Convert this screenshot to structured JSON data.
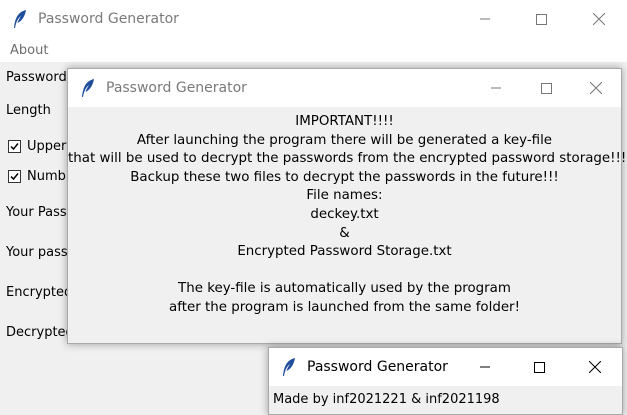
{
  "main_window": {
    "title": "Password Generator",
    "menu": [
      "About"
    ],
    "labels": {
      "password": "Password",
      "length": "Length",
      "upper": "Upper",
      "numbers": "Numb",
      "your_pass": "Your Pass",
      "your_pass2": "Your pass",
      "encrypted": "Encrypted",
      "decrypted": "Decrypted"
    },
    "checkbox_upper_checked": true,
    "checkbox_numbers_checked": true
  },
  "info_dialog": {
    "title": "Password Generator",
    "lines": [
      "IMPORTANT!!!!",
      "After launching the program there will be generated a key-file",
      "that will be used to decrypt the passwords from the encrypted password storage!!!",
      "Backup these two files to decrypt the passwords in the future!!!",
      "File names:",
      "deckey.txt",
      "&",
      "Encrypted Password Storage.txt",
      "",
      "The key-file is automatically used by the program",
      "after the program is launched from the same folder!"
    ]
  },
  "credits_dialog": {
    "title": "Password Generator",
    "text": "Made by inf2021221 & inf2021198"
  },
  "colors": {
    "window_bg": "#f0f0f0",
    "titlebar_bg": "#ffffff",
    "feather_blue": "#1f4e9c"
  },
  "icons": [
    "feather-icon",
    "minimize-icon",
    "maximize-icon",
    "close-icon",
    "checkmark-icon"
  ]
}
